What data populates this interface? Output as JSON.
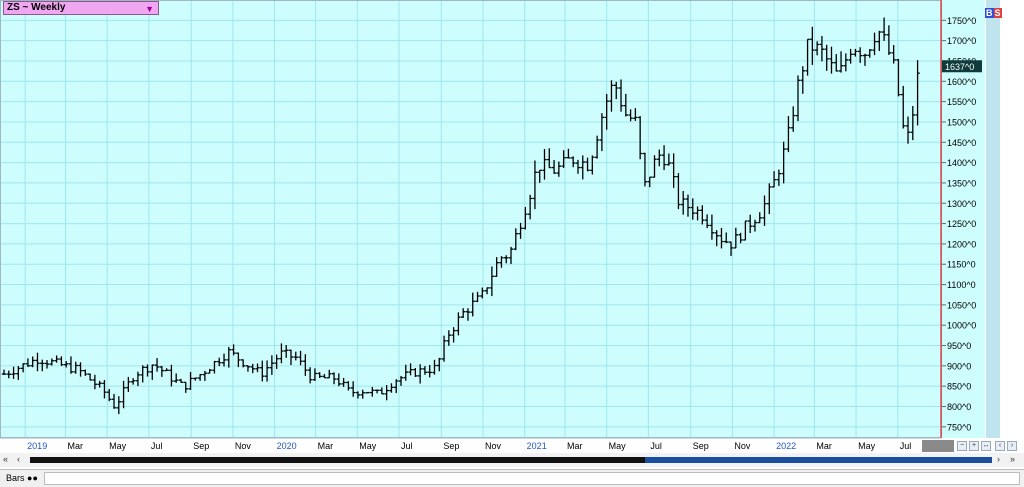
{
  "window": {
    "title": "ZS ~ Weekly"
  },
  "badges": {
    "b": "B",
    "s": "S"
  },
  "status": {
    "label": "Bars"
  },
  "colors": {
    "plot_bg": "#cdfdfd",
    "grid": "#9fe6ee",
    "bar": "#000000",
    "last_price_bg": "#0f3b3b",
    "separator": "#e05050",
    "x_label_year": "#2255cc"
  },
  "chart_data": {
    "type": "ohlc",
    "title": "ZS ~ Weekly",
    "last_price_label": "1637^0",
    "y_ticks": [
      {
        "value": 750,
        "label": "750^0"
      },
      {
        "value": 800,
        "label": "800^0"
      },
      {
        "value": 850,
        "label": "850^0"
      },
      {
        "value": 900,
        "label": "900^0"
      },
      {
        "value": 950,
        "label": "950^0"
      },
      {
        "value": 1000,
        "label": "1000^0"
      },
      {
        "value": 1050,
        "label": "1050^0"
      },
      {
        "value": 1100,
        "label": "1100^0"
      },
      {
        "value": 1150,
        "label": "1150^0"
      },
      {
        "value": 1200,
        "label": "1200^0"
      },
      {
        "value": 1250,
        "label": "1250^0"
      },
      {
        "value": 1300,
        "label": "1300^0"
      },
      {
        "value": 1350,
        "label": "1350^0"
      },
      {
        "value": 1400,
        "label": "1400^0"
      },
      {
        "value": 1450,
        "label": "1450^0"
      },
      {
        "value": 1500,
        "label": "1500^0"
      },
      {
        "value": 1550,
        "label": "1550^0"
      },
      {
        "value": 1600,
        "label": "1600^0"
      },
      {
        "value": 1650,
        "label": "1650^0"
      },
      {
        "value": 1700,
        "label": "1700^0"
      },
      {
        "value": 1750,
        "label": "1750^0"
      }
    ],
    "ylim": [
      725,
      1800
    ],
    "x_ticks": [
      {
        "label": "2019",
        "date": "2019-01-01",
        "year": true
      },
      {
        "label": "Mar",
        "date": "2019-03-01"
      },
      {
        "label": "May",
        "date": "2019-05-01"
      },
      {
        "label": "Jul",
        "date": "2019-07-01"
      },
      {
        "label": "Sep",
        "date": "2019-09-01"
      },
      {
        "label": "Nov",
        "date": "2019-11-01"
      },
      {
        "label": "2020",
        "date": "2020-01-01",
        "year": true
      },
      {
        "label": "Mar",
        "date": "2020-03-01"
      },
      {
        "label": "May",
        "date": "2020-05-01"
      },
      {
        "label": "Jul",
        "date": "2020-07-01"
      },
      {
        "label": "Sep",
        "date": "2020-09-01"
      },
      {
        "label": "Nov",
        "date": "2020-11-01"
      },
      {
        "label": "2021",
        "date": "2021-01-01",
        "year": true
      },
      {
        "label": "Mar",
        "date": "2021-03-01"
      },
      {
        "label": "May",
        "date": "2021-05-01"
      },
      {
        "label": "Jul",
        "date": "2021-07-01"
      },
      {
        "label": "Sep",
        "date": "2021-09-01"
      },
      {
        "label": "Nov",
        "date": "2021-11-01"
      },
      {
        "label": "2022",
        "date": "2022-01-01",
        "year": true
      },
      {
        "label": "Mar",
        "date": "2022-03-01"
      },
      {
        "label": "May",
        "date": "2022-05-01"
      },
      {
        "label": "Jul",
        "date": "2022-07-01"
      }
    ],
    "anchors": [
      [
        "2018-12-01",
        880
      ],
      [
        "2019-01-20",
        918
      ],
      [
        "2019-03-20",
        890
      ],
      [
        "2019-04-25",
        840
      ],
      [
        "2019-05-12",
        800
      ],
      [
        "2019-06-10",
        880
      ],
      [
        "2019-07-08",
        905
      ],
      [
        "2019-08-20",
        848
      ],
      [
        "2019-09-15",
        880
      ],
      [
        "2019-10-25",
        935
      ],
      [
        "2019-11-25",
        900
      ],
      [
        "2019-12-12",
        880
      ],
      [
        "2020-01-10",
        930
      ],
      [
        "2020-02-01",
        920
      ],
      [
        "2020-02-25",
        870
      ],
      [
        "2020-03-30",
        870
      ],
      [
        "2020-04-20",
        835
      ],
      [
        "2020-05-12",
        840
      ],
      [
        "2020-06-01",
        830
      ],
      [
        "2020-06-25",
        865
      ],
      [
        "2020-07-25",
        885
      ],
      [
        "2020-08-25",
        895
      ],
      [
        "2020-09-10",
        975
      ],
      [
        "2020-10-05",
        1035
      ],
      [
        "2020-10-30",
        1070
      ],
      [
        "2020-11-25",
        1165
      ],
      [
        "2020-12-10",
        1175
      ],
      [
        "2021-01-08",
        1320
      ],
      [
        "2021-01-20",
        1395
      ],
      [
        "2021-02-15",
        1380
      ],
      [
        "2021-03-10",
        1410
      ],
      [
        "2021-04-05",
        1395
      ],
      [
        "2021-04-28",
        1540
      ],
      [
        "2021-05-12",
        1600
      ],
      [
        "2021-05-28",
        1520
      ],
      [
        "2021-06-12",
        1500
      ],
      [
        "2021-06-25",
        1340
      ],
      [
        "2021-07-15",
        1420
      ],
      [
        "2021-07-28",
        1410
      ],
      [
        "2021-08-15",
        1300
      ],
      [
        "2021-09-01",
        1290
      ],
      [
        "2021-09-20",
        1270
      ],
      [
        "2021-10-15",
        1215
      ],
      [
        "2021-11-01",
        1200
      ],
      [
        "2021-11-20",
        1240
      ],
      [
        "2021-12-15",
        1285
      ],
      [
        "2022-01-03",
        1360
      ],
      [
        "2022-01-20",
        1450
      ],
      [
        "2022-02-05",
        1590
      ],
      [
        "2022-02-20",
        1690
      ],
      [
        "2022-03-10",
        1675
      ],
      [
        "2022-04-05",
        1610
      ],
      [
        "2022-04-25",
        1690
      ],
      [
        "2022-05-15",
        1670
      ],
      [
        "2022-06-01",
        1730
      ],
      [
        "2022-06-14",
        1690
      ],
      [
        "2022-06-28",
        1620
      ],
      [
        "2022-07-08",
        1490
      ],
      [
        "2022-07-15",
        1455
      ],
      [
        "2022-07-25",
        1540
      ],
      [
        "2022-08-01",
        1637
      ]
    ]
  }
}
